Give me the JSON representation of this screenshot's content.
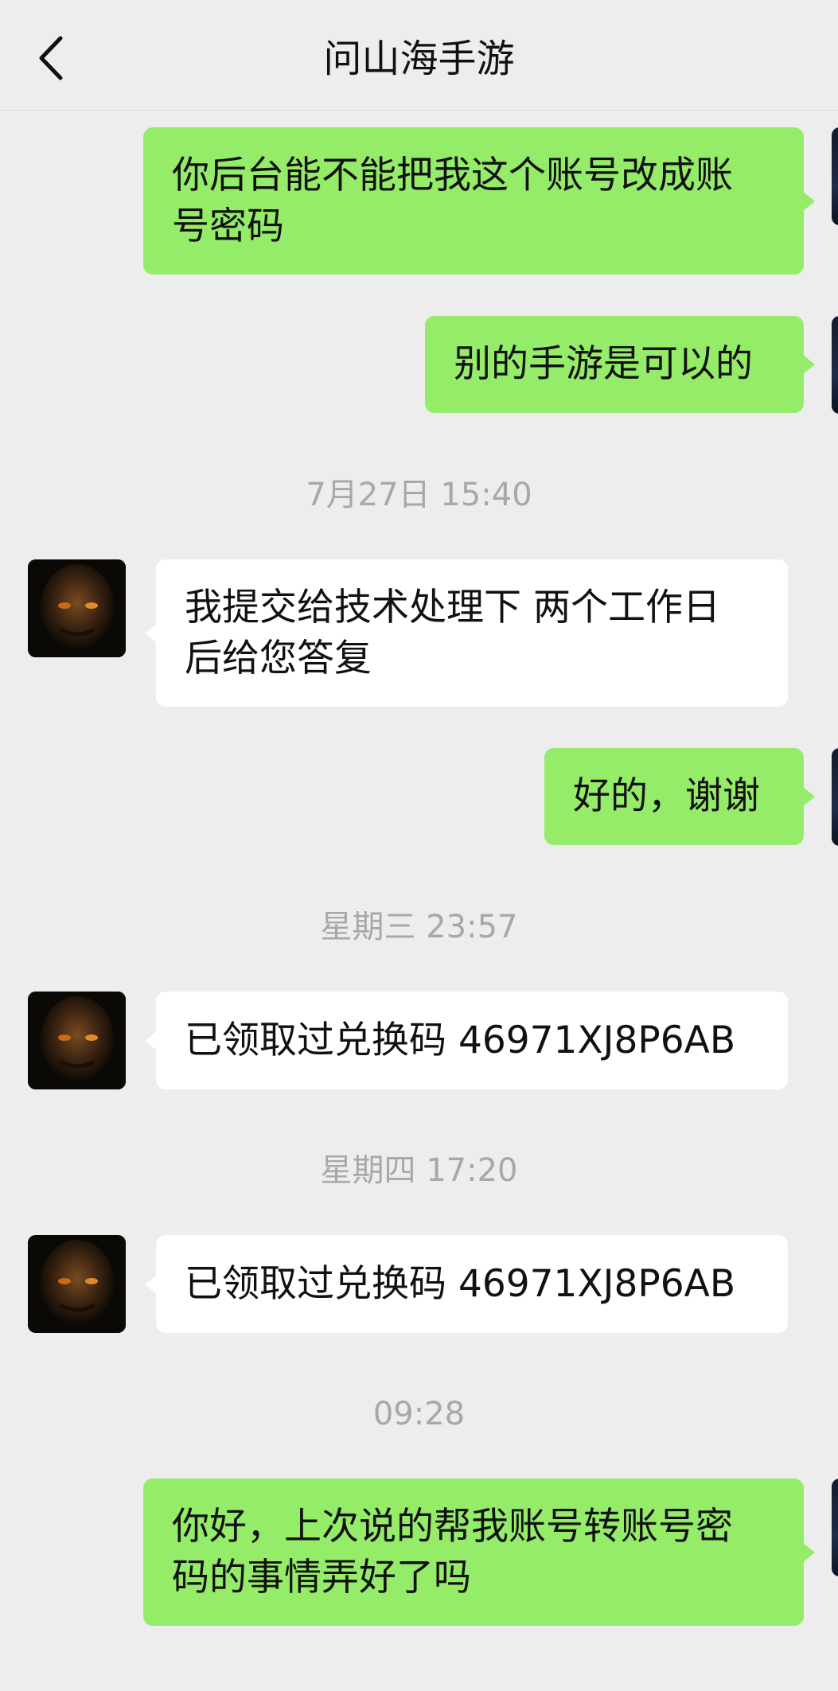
{
  "header": {
    "title": "问山海手游",
    "back_icon": "chevron-left-icon"
  },
  "colors": {
    "background": "#EDEDED",
    "sent_bubble": "#95EC69",
    "received_bubble": "#FFFFFF",
    "timestamp": "#A8A8A8"
  },
  "messages": [
    {
      "side": "right",
      "lines": [
        "你后台能不能把我这个账号改成账",
        "号密码"
      ]
    },
    {
      "side": "right",
      "lines": [
        "别的手游是可以的"
      ]
    },
    {
      "timestamp": "7月27日 15:40"
    },
    {
      "side": "left",
      "lines": [
        "我提交给技术处理下 两个工作日",
        "后给您答复"
      ]
    },
    {
      "side": "right",
      "lines": [
        "好的，谢谢"
      ]
    },
    {
      "timestamp": "星期三 23:57"
    },
    {
      "side": "left",
      "lines": [
        "已领取过兑换码 46971XJ8P6AB"
      ]
    },
    {
      "timestamp": "星期四 17:20"
    },
    {
      "side": "left",
      "lines": [
        "已领取过兑换码 46971XJ8P6AB"
      ]
    },
    {
      "timestamp": "09:28"
    },
    {
      "side": "right",
      "lines": [
        "你好，上次说的帮我账号转账号密",
        "码的事情弄好了吗"
      ]
    }
  ]
}
